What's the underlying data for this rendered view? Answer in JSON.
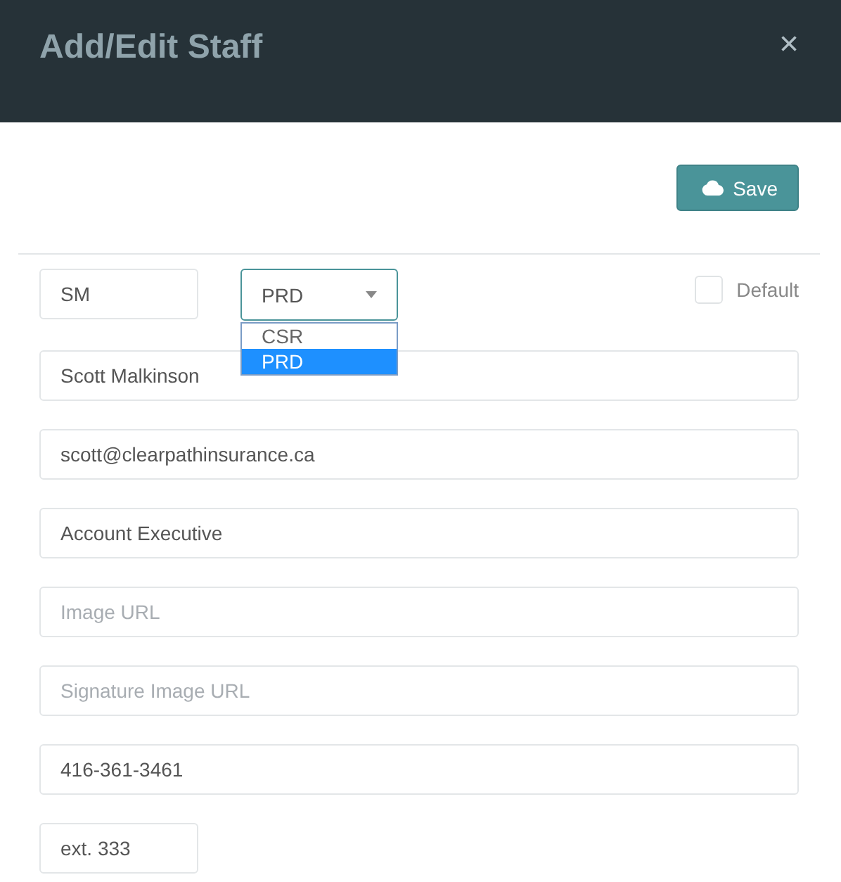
{
  "dialog": {
    "title": "Add/Edit Staff",
    "close": "×"
  },
  "save_button": {
    "label": "Save"
  },
  "initials": {
    "value": "SM"
  },
  "role_select": {
    "value": "PRD",
    "expanded": true,
    "options": [
      {
        "label": "CSR",
        "selected": false
      },
      {
        "label": "PRD",
        "selected": true
      }
    ]
  },
  "default_checkbox": {
    "label": "Default",
    "checked": false
  },
  "fields": [
    {
      "kind": "wide",
      "value": "Scott Malkinson"
    },
    {
      "kind": "wide",
      "value": "scott@clearpathinsurance.ca"
    },
    {
      "kind": "wide",
      "value": "Account Executive"
    },
    {
      "kind": "wide",
      "placeholder": "Image URL"
    },
    {
      "kind": "wide",
      "placeholder": "Signature Image URL"
    },
    {
      "kind": "wide",
      "value": "416-361-3461"
    },
    {
      "kind": "narrow",
      "value": "ext. 333"
    }
  ]
}
